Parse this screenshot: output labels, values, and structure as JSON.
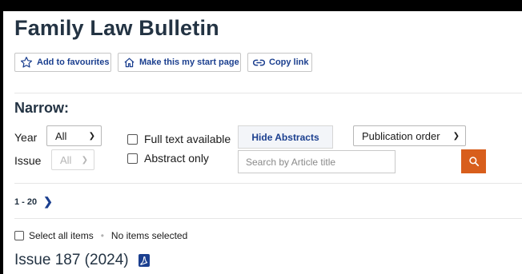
{
  "header": {
    "title": "Family Law Bulletin"
  },
  "actions": {
    "add_favourites": "Add to favourites",
    "start_page": "Make this my start page",
    "copy_link": "Copy link"
  },
  "filters": {
    "narrow_label": "Narrow:",
    "year_label": "Year",
    "year_value": "All",
    "issue_label": "Issue",
    "issue_value": "All",
    "full_text_label": "Full text available",
    "abstract_only_label": "Abstract only",
    "hide_abstracts_label": "Hide Abstracts",
    "order_value": "Publication order",
    "search_placeholder": "Search by Article title"
  },
  "pagination": {
    "range": "1 - 20"
  },
  "selection": {
    "select_all_label": "Select all items",
    "status": "No items selected"
  },
  "issue": {
    "heading": "Issue 187 (2024)"
  },
  "colors": {
    "accent": "#1b3f8f",
    "title": "#233343",
    "search_button": "#d85e1c"
  },
  "icons": [
    "star-outline-icon",
    "home-icon",
    "link-icon",
    "chevron-down-icon",
    "search-icon",
    "chevron-right-icon",
    "pdf-icon"
  ]
}
